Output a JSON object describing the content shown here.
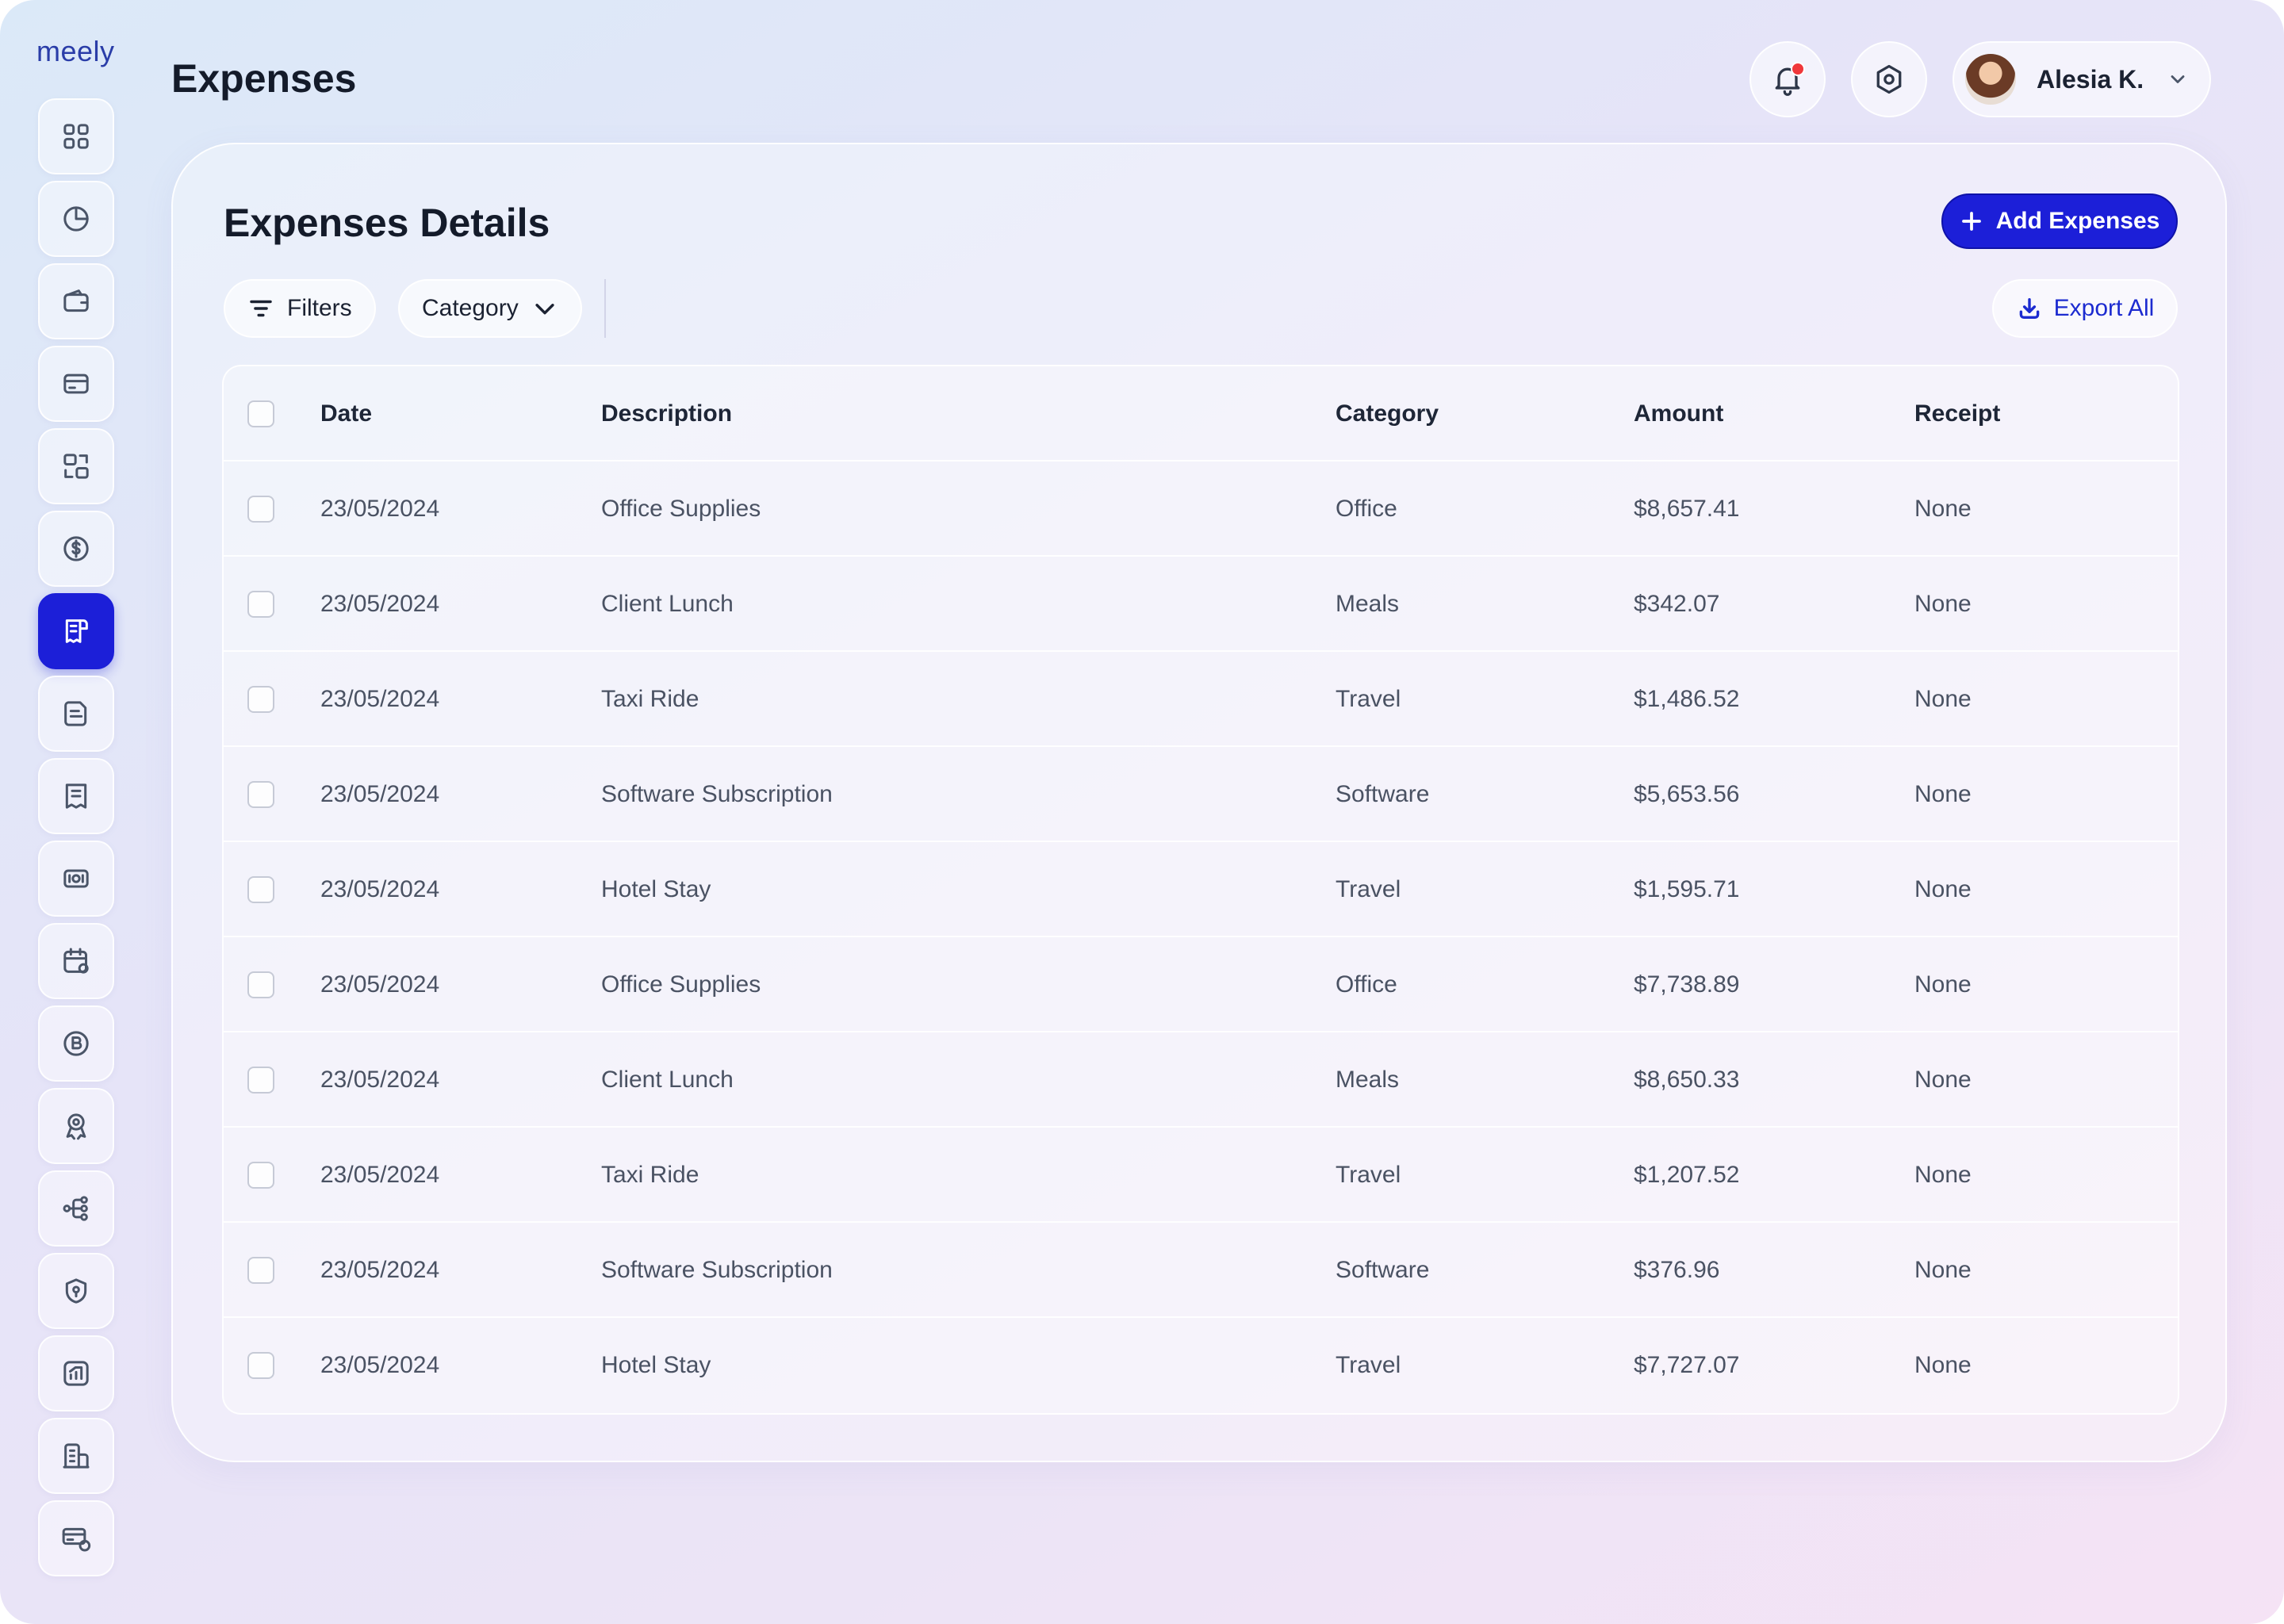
{
  "brand": "meely",
  "header": {
    "title": "Expenses",
    "user_name": "Alesia K."
  },
  "sidebar": {
    "items": [
      {
        "icon": "grid-icon"
      },
      {
        "icon": "pie-chart-icon"
      },
      {
        "icon": "wallet-icon"
      },
      {
        "icon": "credit-card-icon"
      },
      {
        "icon": "exchange-icon"
      },
      {
        "icon": "dollar-icon"
      },
      {
        "icon": "receipt-icon",
        "active": true
      },
      {
        "icon": "document-icon"
      },
      {
        "icon": "bill-icon"
      },
      {
        "icon": "money-icon"
      },
      {
        "icon": "calendar-icon"
      },
      {
        "icon": "bitcoin-icon"
      },
      {
        "icon": "award-icon"
      },
      {
        "icon": "network-icon"
      },
      {
        "icon": "shield-icon"
      },
      {
        "icon": "chart-icon"
      },
      {
        "icon": "building-icon"
      },
      {
        "icon": "payment-card-icon"
      }
    ]
  },
  "card": {
    "title": "Expenses Details",
    "add_label": "Add Expenses",
    "filters_label": "Filters",
    "category_label": "Category",
    "export_label": "Export All"
  },
  "table": {
    "columns": [
      "Date",
      "Description",
      "Category",
      "Amount",
      "Receipt"
    ],
    "rows": [
      {
        "date": "23/05/2024",
        "description": "Office Supplies",
        "category": "Office",
        "amount": "$8,657.41",
        "receipt": "None"
      },
      {
        "date": "23/05/2024",
        "description": "Client Lunch",
        "category": "Meals",
        "amount": "$342.07",
        "receipt": "None"
      },
      {
        "date": "23/05/2024",
        "description": "Taxi Ride",
        "category": "Travel",
        "amount": "$1,486.52",
        "receipt": "None"
      },
      {
        "date": "23/05/2024",
        "description": "Software Subscription",
        "category": "Software",
        "amount": "$5,653.56",
        "receipt": "None"
      },
      {
        "date": "23/05/2024",
        "description": "Hotel Stay",
        "category": "Travel",
        "amount": "$1,595.71",
        "receipt": "None"
      },
      {
        "date": "23/05/2024",
        "description": "Office Supplies",
        "category": "Office",
        "amount": "$7,738.89",
        "receipt": "None"
      },
      {
        "date": "23/05/2024",
        "description": "Client Lunch",
        "category": "Meals",
        "amount": "$8,650.33",
        "receipt": "None"
      },
      {
        "date": "23/05/2024",
        "description": "Taxi Ride",
        "category": "Travel",
        "amount": "$1,207.52",
        "receipt": "None"
      },
      {
        "date": "23/05/2024",
        "description": "Software Subscription",
        "category": "Software",
        "amount": "$376.96",
        "receipt": "None"
      },
      {
        "date": "23/05/2024",
        "description": "Hotel Stay",
        "category": "Travel",
        "amount": "$7,727.07",
        "receipt": "None"
      }
    ]
  },
  "colors": {
    "accent": "#1c1fd8",
    "notification": "#f0373a",
    "export_text": "#1c2bd0"
  }
}
